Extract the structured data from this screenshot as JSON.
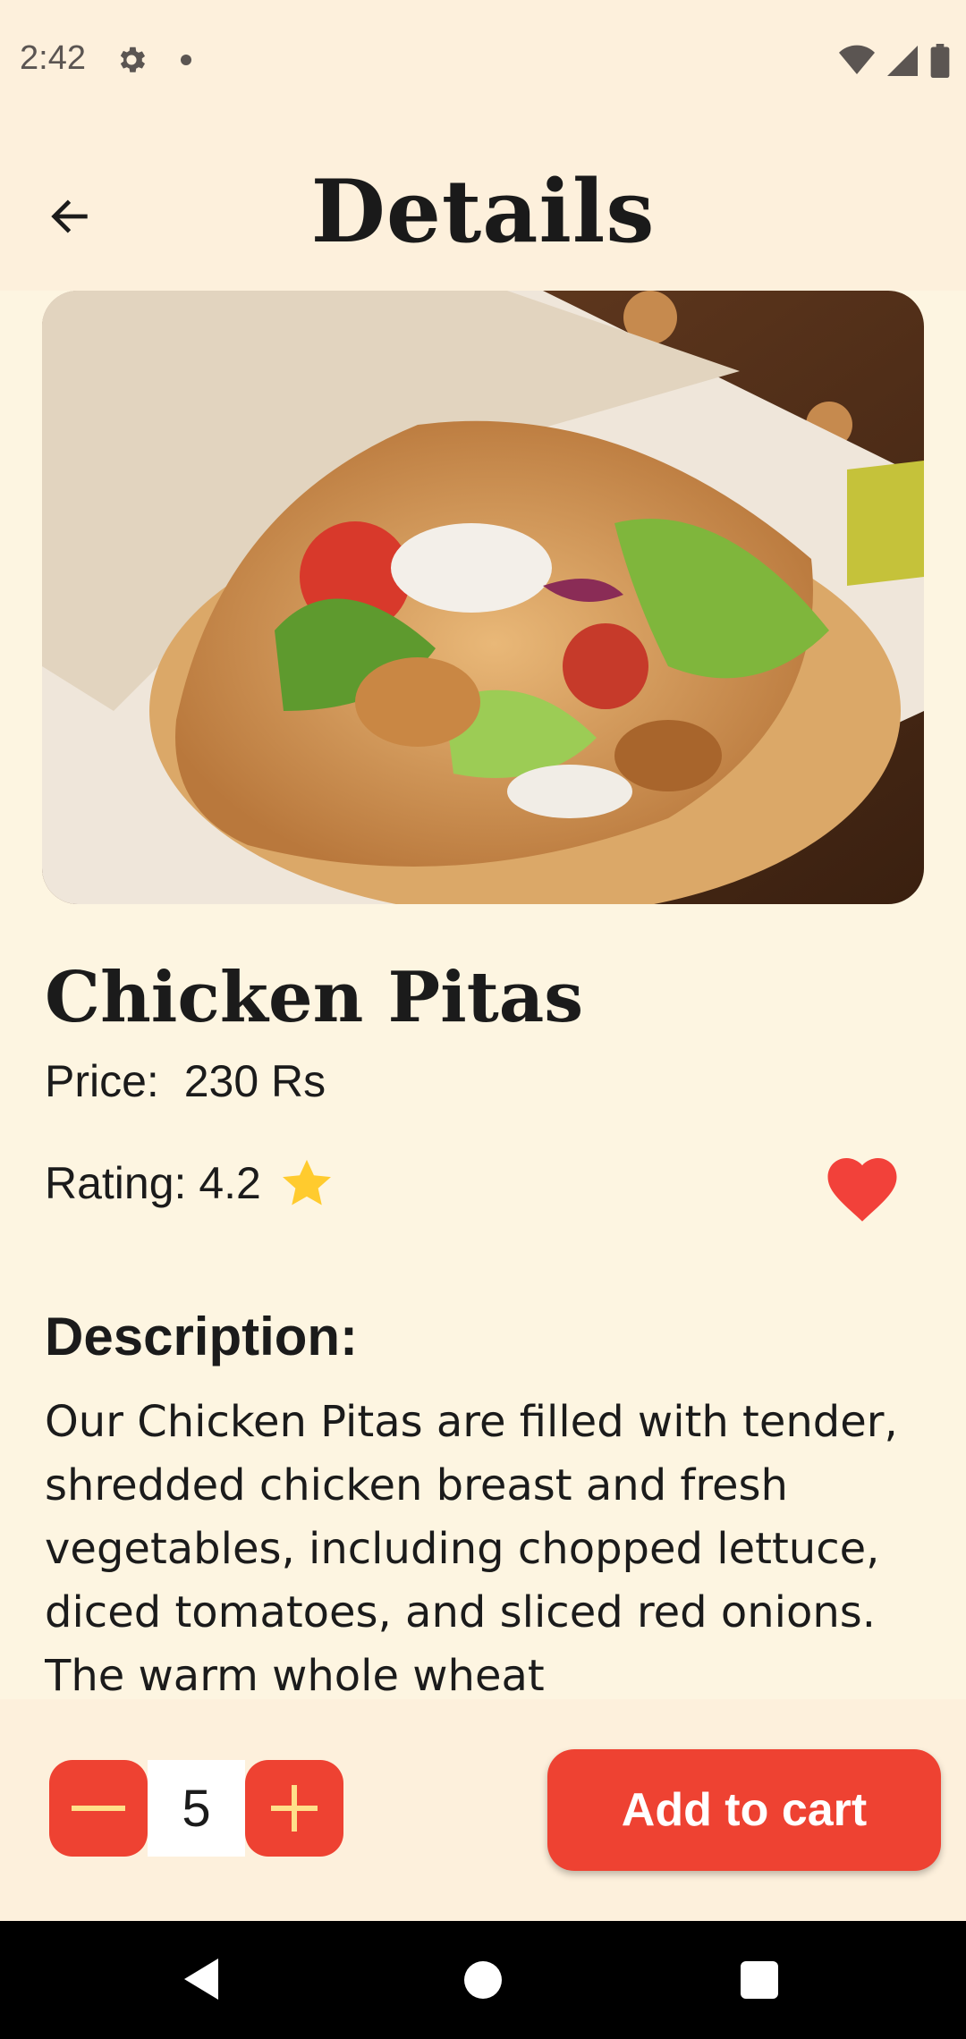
{
  "status_bar": {
    "time": "2:42",
    "icons": [
      "gear-icon",
      "notification-dot-icon",
      "wifi-icon",
      "cell-signal-icon",
      "battery-icon"
    ]
  },
  "app_bar": {
    "title": "Details",
    "back_icon": "arrow-left-icon"
  },
  "item": {
    "name": "Chicken Pitas",
    "price_label": "Price:",
    "price_value": "230 Rs",
    "rating_label": "Rating:",
    "rating_value": "4.2",
    "favorite": true,
    "description_heading": "Description:",
    "description": "Our Chicken Pitas are filled with tender, shredded chicken breast and fresh vegetables, including chopped lettuce, diced tomatoes, and sliced red onions. The warm whole wheat"
  },
  "cart": {
    "quantity": "5",
    "add_label": "Add to cart"
  },
  "colors": {
    "accent": "#EE4232",
    "background": "#FDF0DC",
    "content_background": "#FDF5E1",
    "star": "#FFCB2E",
    "heart": "#F2413A"
  }
}
